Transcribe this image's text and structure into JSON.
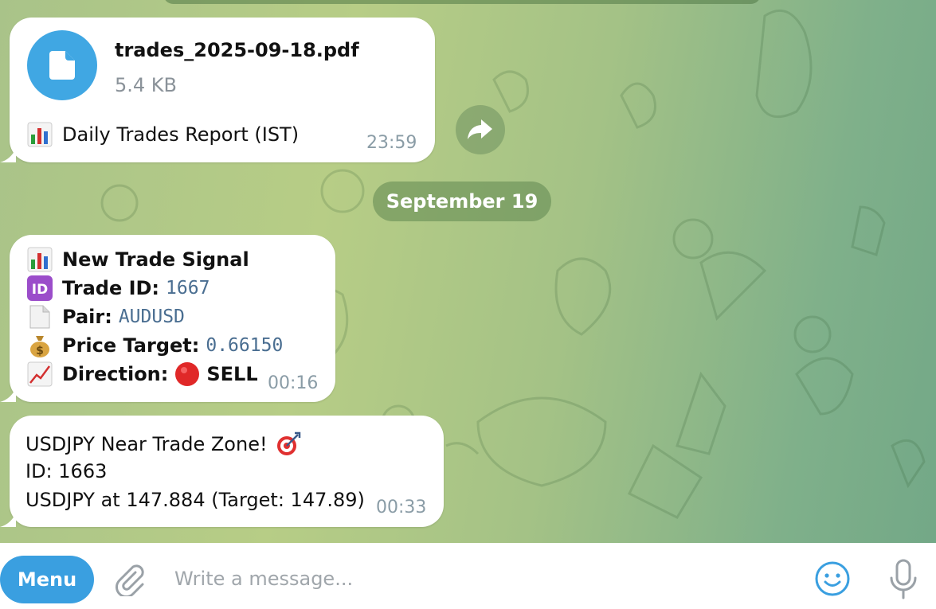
{
  "messages": {
    "file": {
      "name": "trades_2025-09-18.pdf",
      "size": "5.4 KB",
      "caption_emoji": "bar-chart-emoji",
      "caption": "Daily Trades Report (IST)",
      "time": "23:59"
    },
    "date_separator": "September 19",
    "signal": {
      "title": "New Trade Signal",
      "trade_id_label": "Trade ID:",
      "trade_id_value": "1667",
      "pair_label": "Pair:",
      "pair_value": "AUDUSD",
      "price_label": "Price Target:",
      "price_value": "0.66150",
      "direction_label": "Direction:",
      "direction_value": "SELL",
      "time": "00:16"
    },
    "zone": {
      "line1": "USDJPY Near Trade Zone!",
      "line2": "ID: 1663",
      "line3": "USDJPY at 147.884 (Target: 147.89)",
      "time": "00:33"
    }
  },
  "composer": {
    "menu_label": "Menu",
    "placeholder": "Write a message..."
  },
  "colors": {
    "accent": "#40a7e3",
    "menu_button": "#3a9fe0",
    "mono_value": "#4a6e91",
    "time_text": "#8a9ca6"
  }
}
